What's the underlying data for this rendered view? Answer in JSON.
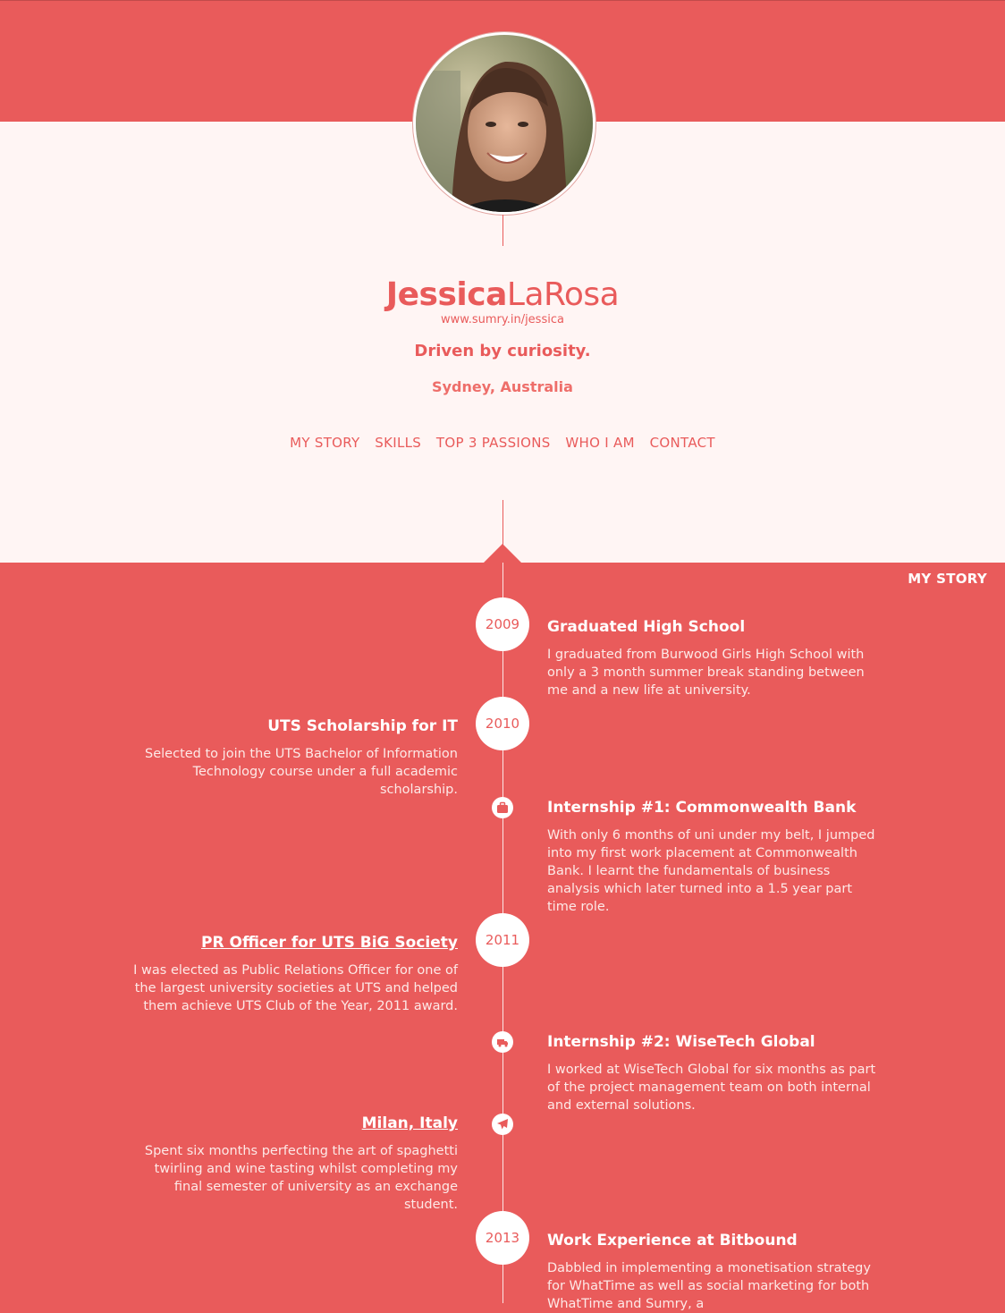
{
  "profile": {
    "first_name": "Jessica",
    "last_name": "LaRosa",
    "url": "www.sumry.in/jessica",
    "tagline": "Driven by curiosity.",
    "location": "Sydney, Australia"
  },
  "nav": {
    "items": [
      "MY STORY",
      "SKILLS",
      "TOP 3 PASSIONS",
      "WHO I AM",
      "CONTACT"
    ]
  },
  "section": {
    "label": "MY STORY"
  },
  "timeline": {
    "years": [
      "2009",
      "2010",
      "2011",
      "2013"
    ],
    "entries": [
      {
        "title": "Graduated High School",
        "text": "I graduated from Burwood Girls High School with only a 3 month summer break standing between me and a new life at university."
      },
      {
        "title": "UTS Scholarship for IT",
        "text": "Selected to join the UTS Bachelor of Information Technology course under a full academic scholarship."
      },
      {
        "title": "Internship #1: Commonwealth Bank",
        "text": "With only 6 months of uni under my belt, I jumped into my first work placement at Commonwealth Bank. I learnt the fundamentals of business analysis which later turned into a 1.5 year part time role.",
        "icon": "briefcase-icon"
      },
      {
        "title": "PR Officer for UTS BiG Society",
        "text": "I was elected as Public Relations Officer for one of the largest university societies at UTS and helped them achieve UTS Club of the Year, 2011 award."
      },
      {
        "title": "Internship #2: WiseTech Global",
        "text": "I worked at WiseTech Global for six months as part of the project management team on both internal and external solutions.",
        "icon": "truck-icon"
      },
      {
        "title": "Milan, Italy",
        "text": "Spent six months perfecting the art of spaghetti twirling and wine tasting whilst completing my final semester of university as an exchange student.",
        "icon": "airplane-icon"
      },
      {
        "title": "Work Experience at Bitbound",
        "text": "Dabbled in implementing a monetisation strategy for WhatTime as well as social marketing for both WhatTime and Sumry, a"
      }
    ]
  },
  "colors": {
    "accent": "#e95b5b",
    "background": "#fff5f4"
  }
}
